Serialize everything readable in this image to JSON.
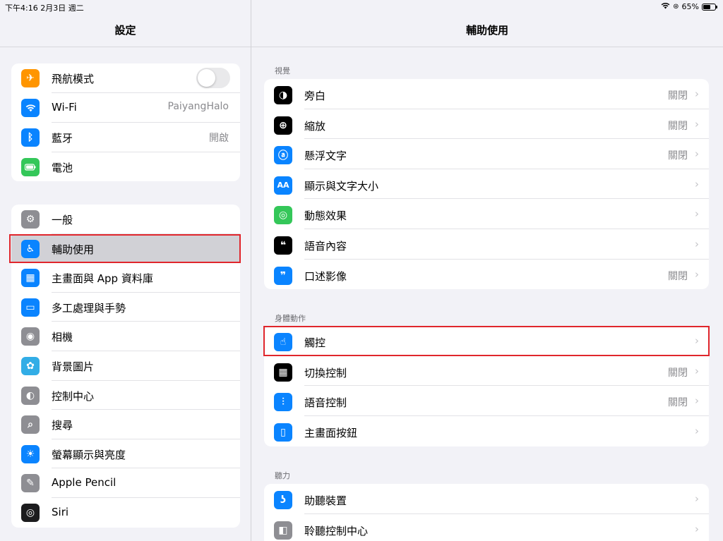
{
  "status_bar": {
    "time": "下午4:16  2月3日 週二",
    "battery_text": "65%",
    "battery_level": 0.65
  },
  "sidebar": {
    "title": "設定",
    "group1": [
      {
        "label": "飛航模式",
        "value": "",
        "toggle": false,
        "icon": "airplane-icon",
        "color": "#ff9500"
      },
      {
        "label": "Wi-Fi",
        "value": "PaiyangHalo",
        "icon": "wifi-icon",
        "color": "#0a84ff"
      },
      {
        "label": "藍牙",
        "value": "開啟",
        "icon": "bluetooth-icon",
        "color": "#0a84ff"
      },
      {
        "label": "電池",
        "value": "",
        "icon": "battery-icon",
        "color": "#34c759"
      }
    ],
    "group2": [
      {
        "label": "一般",
        "icon": "gear-icon",
        "color": "#8e8e93"
      },
      {
        "label": "輔助使用",
        "icon": "accessibility-icon",
        "color": "#0a84ff",
        "selected": true
      },
      {
        "label": "主畫面與 App 資料庫",
        "icon": "home-screen-icon",
        "color": "#0a84ff"
      },
      {
        "label": "多工處理與手勢",
        "icon": "multitasking-icon",
        "color": "#0a84ff"
      },
      {
        "label": "相機",
        "icon": "camera-icon",
        "color": "#8e8e93"
      },
      {
        "label": "背景圖片",
        "icon": "wallpaper-icon",
        "color": "#32ade6"
      },
      {
        "label": "控制中心",
        "icon": "control-center-icon",
        "color": "#8e8e93"
      },
      {
        "label": "搜尋",
        "icon": "search-icon",
        "color": "#8e8e93"
      },
      {
        "label": "螢幕顯示與亮度",
        "icon": "brightness-icon",
        "color": "#0a84ff"
      },
      {
        "label": "Apple Pencil",
        "icon": "pencil-icon",
        "color": "#8e8e93"
      },
      {
        "label": "Siri",
        "icon": "siri-icon",
        "color": "#1c1c1e"
      }
    ]
  },
  "detail": {
    "title": "輔助使用",
    "sections": [
      {
        "header": "視覺",
        "rows": [
          {
            "label": "旁白",
            "value": "關閉",
            "icon": "voiceover-icon",
            "color": "#000000"
          },
          {
            "label": "縮放",
            "value": "關閉",
            "icon": "zoom-icon",
            "color": "#000000"
          },
          {
            "label": "懸浮文字",
            "value": "關閉",
            "icon": "hover-text-icon",
            "color": "#0a84ff"
          },
          {
            "label": "顯示與文字大小",
            "value": "",
            "icon": "text-size-icon",
            "color": "#0a84ff"
          },
          {
            "label": "動態效果",
            "value": "",
            "icon": "motion-icon",
            "color": "#34c759"
          },
          {
            "label": "語音內容",
            "value": "",
            "icon": "spoken-content-icon",
            "color": "#000000"
          },
          {
            "label": "口述影像",
            "value": "關閉",
            "icon": "audio-description-icon",
            "color": "#0a84ff"
          }
        ]
      },
      {
        "header": "身體動作",
        "rows": [
          {
            "label": "觸控",
            "value": "",
            "icon": "touch-icon",
            "color": "#0a84ff",
            "highlighted": true
          },
          {
            "label": "切換控制",
            "value": "關閉",
            "icon": "switch-control-icon",
            "color": "#000000"
          },
          {
            "label": "語音控制",
            "value": "關閉",
            "icon": "voice-control-icon",
            "color": "#0a84ff"
          },
          {
            "label": "主畫面按鈕",
            "value": "",
            "icon": "home-button-icon",
            "color": "#0a84ff"
          }
        ]
      },
      {
        "header": "聽力",
        "rows": [
          {
            "label": "助聽裝置",
            "value": "",
            "icon": "hearing-devices-icon",
            "color": "#0a84ff"
          },
          {
            "label": "聆聽控制中心",
            "value": "",
            "icon": "hearing-control-center-icon",
            "color": "#8e8e93"
          }
        ]
      }
    ]
  },
  "icons": {
    "airplane-icon": "✈",
    "wifi-icon": "◠",
    "bluetooth-icon": "ᛒ",
    "battery-icon": "▬",
    "gear-icon": "⚙",
    "accessibility-icon": "♿",
    "home-screen-icon": "▦",
    "multitasking-icon": "▭",
    "camera-icon": "◉",
    "wallpaper-icon": "✿",
    "control-center-icon": "◐",
    "search-icon": "⌕",
    "brightness-icon": "☀",
    "pencil-icon": "✎",
    "siri-icon": "◎",
    "voiceover-icon": "◑",
    "zoom-icon": "⊕",
    "hover-text-icon": "ⓐ",
    "text-size-icon": "AA",
    "motion-icon": "◎",
    "spoken-content-icon": "❝",
    "audio-description-icon": "❞",
    "touch-icon": "☝",
    "switch-control-icon": "▦",
    "voice-control-icon": "⫶",
    "home-button-icon": "▯",
    "hearing-devices-icon": "ʖ",
    "hearing-control-center-icon": "◧"
  }
}
